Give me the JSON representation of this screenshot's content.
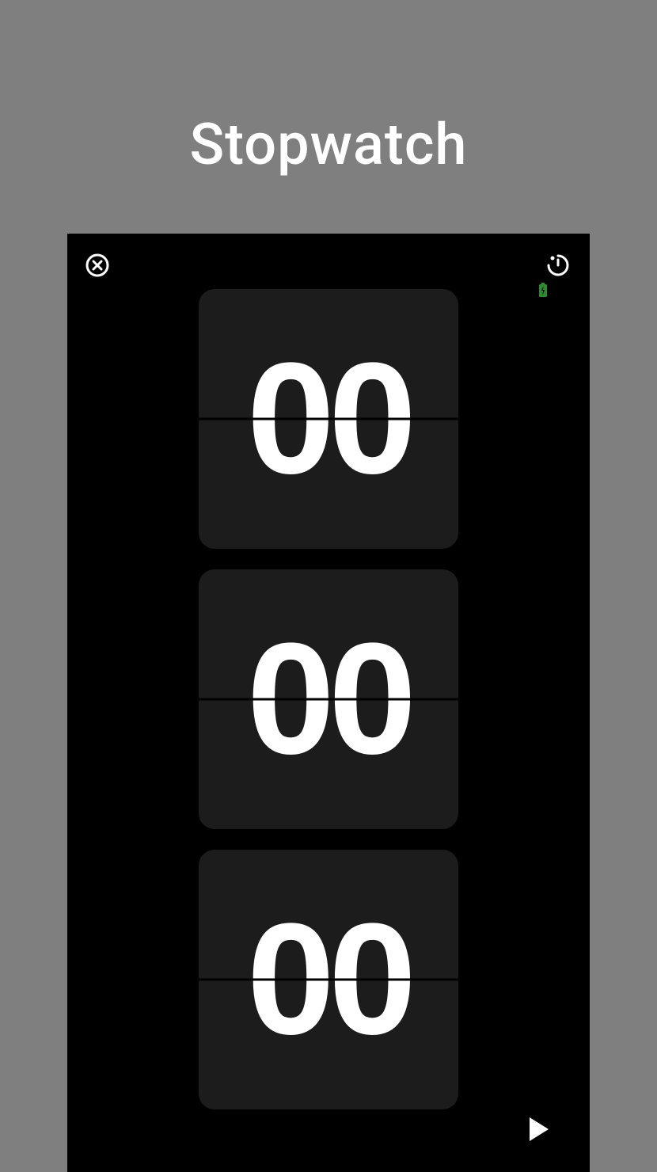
{
  "title": "Stopwatch",
  "time": {
    "hours": "00",
    "minutes": "00",
    "seconds": "00"
  },
  "icons": {
    "close": "close-circle",
    "timer": "timer",
    "battery": "battery-charging",
    "play": "play"
  },
  "colors": {
    "background": "#7f7f7f",
    "phone": "#000000",
    "card": "#1c1c1c",
    "text": "#ffffff",
    "battery": "#2e8b2e"
  }
}
